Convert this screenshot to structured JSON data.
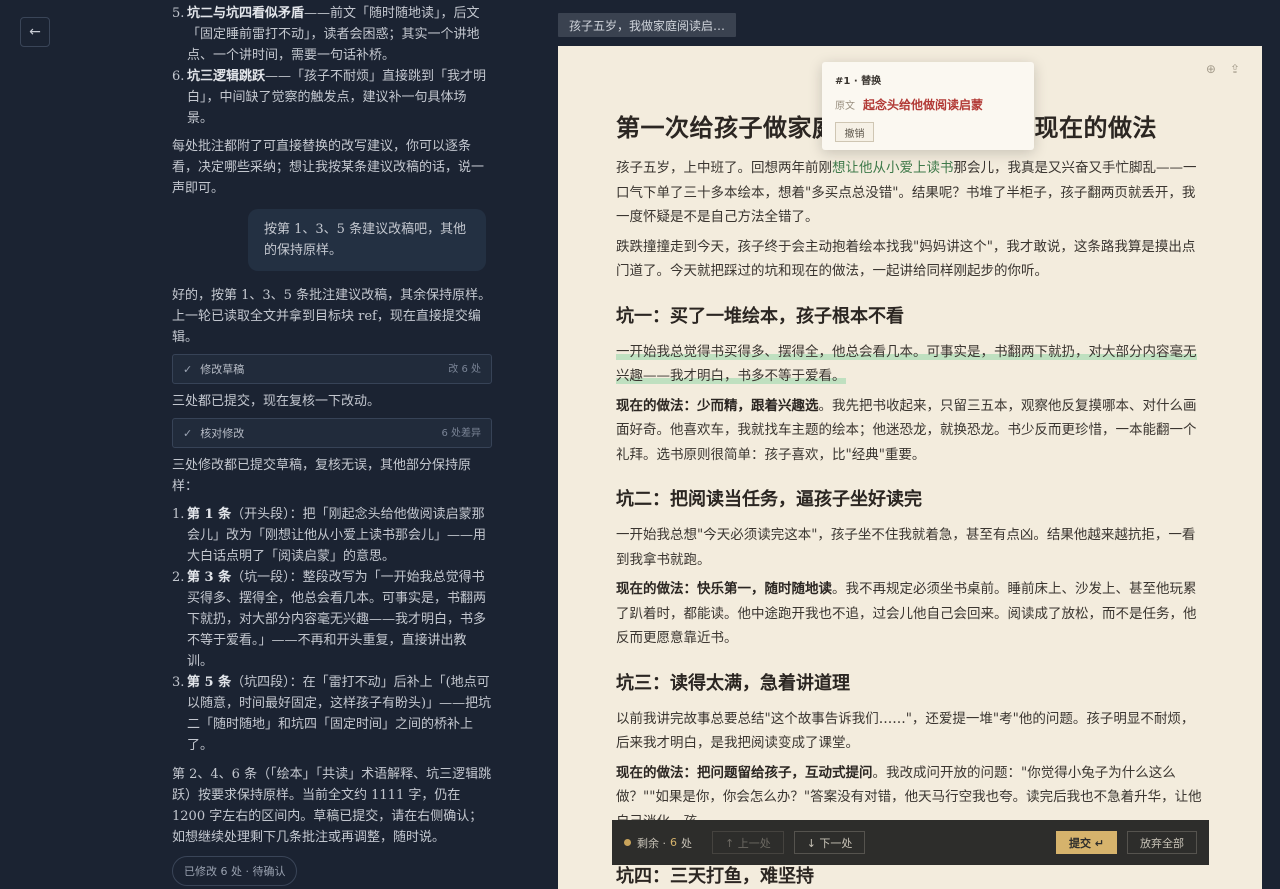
{
  "nav": {
    "back_icon": "←"
  },
  "chat": {
    "top_list": [
      {
        "num": "5.",
        "title": "坑二与坑四看似矛盾",
        "text": "——前文「随时随地读」，后文「固定睡前雷打不动」，读者会困惑；其实一个讲地点、一个讲时间，需要一句话补桥。"
      },
      {
        "num": "6.",
        "title": "坑三逻辑跳跃",
        "text": "——「孩子不耐烦」直接跳到「我才明白」，中间缺了觉察的触发点，建议补一句具体场景。"
      }
    ],
    "p1": "每处批注都附了可直接替换的改写建议，你可以逐条看，决定哪些采纳；想让我按某条建议改稿的话，说一声即可。",
    "user_msg": "按第 1、3、5 条建议改稿吧，其他的保持原样。",
    "p2": "好的，按第 1、3、5 条批注建议改稿，其余保持原样。上一轮已读取全文并拿到目标块 ref，现在直接提交编辑。",
    "tool1": {
      "label": "修改草稿",
      "right": "改 6 处",
      "icon": "✓"
    },
    "p3": "三处都已提交，现在复核一下改动。",
    "tool2": {
      "label": "核对修改",
      "right": "6 处差异",
      "icon": "✓"
    },
    "p4": "三处修改都已提交草稿，复核无误，其他部分保持原样：",
    "changes": [
      {
        "num": "1.",
        "title": "第 1 条",
        "text": "（开头段）：把「刚起念头给他做阅读启蒙那会儿」改为「刚想让他从小爱上读书那会儿」——用大白话点明了「阅读启蒙」的意思。"
      },
      {
        "num": "2.",
        "title": "第 3 条",
        "text": "（坑一段）：整段改写为「一开始我总觉得书买得多、摆得全，他总会看几本。可事实是，书翻两下就扔，对大部分内容毫无兴趣——我才明白，书多不等于爱看。」——不再和开头重复，直接讲出教训。"
      },
      {
        "num": "3.",
        "title": "第 5 条",
        "text": "（坑四段）：在「雷打不动」后补上「(地点可以随意，时间最好固定，这样孩子有盼头)」——把坑二「随时随地」和坑四「固定时间」之间的桥补上了。"
      }
    ],
    "p5": "第 2、4、6 条（「绘本」「共读」术语解释、坑三逻辑跳跃）按要求保持原样。当前全文约 1111 字，仍在 1200 字左右的区间内。草稿已提交，请在右侧确认；如想继续处理剩下几条批注或再调整，随时说。",
    "status": "已修改  6  处  ·  待确认"
  },
  "doc": {
    "tab_title": "孩子五岁，我做家庭阅读启…",
    "icons": [
      "zoom-icon",
      "share-icon"
    ],
    "h1_left": "第一次给孩子做家庭",
    "h1_right": "坑和现在的做法",
    "intro1_a": "孩子五岁，上中班了。回想两年前刚",
    "intro1_ins": "想让他从小爱上读书",
    "intro1_b": "那会儿，我真是又兴奋又手忙脚乱——一口气下单了三十多本绘本，想着\"多买点总没错\"。结果呢？书堆了半柜子，孩子翻两页就丢开，我一度怀疑是不是自己方法全错了。",
    "intro2": "跌跌撞撞走到今天，孩子终于会主动抱着绘本找我\"妈妈讲这个\"，我才敢说，这条路我算是摸出点门道了。今天就把踩过的坑和现在的做法，一起讲给同样刚起步的你听。",
    "s1_title": "坑一：买了一堆绘本，孩子根本不看",
    "s1_p1": "一开始我总觉得书买得多、摆得全，他总会看几本。可事实是，书翻两下就扔，对大部分内容毫无兴趣——我才明白，书多不等于爱看。",
    "s1_now_label": "现在的做法：少而精，跟着兴趣选",
    "s1_now": "。我先把书收起来，只留三五本，观察他反复摸哪本、对什么画面好奇。他喜欢车，我就找车主题的绘本；他迷恐龙，就换恐龙。书少反而更珍惜，一本能翻一个礼拜。选书原则很简单：孩子喜欢，比\"经典\"重要。",
    "s2_title": "坑二：把阅读当任务，逼孩子坐好读完",
    "s2_p1": "一开始我总想\"今天必须读完这本\"，孩子坐不住我就着急，甚至有点凶。结果他越来越抗拒，一看到我拿书就跑。",
    "s2_now_label": "现在的做法：快乐第一，随时随地读",
    "s2_now": "。我不再规定必须坐书桌前。睡前床上、沙发上、甚至他玩累了趴着时，都能读。他中途跑开我也不追，过会儿他自己会回来。阅读成了放松，而不是任务，他反而更愿意靠近书。",
    "s3_title": "坑三：读得太满，急着讲道理",
    "s3_p1": "以前我讲完故事总要总结\"这个故事告诉我们……\"，还爱提一堆\"考\"他的问题。孩子明显不耐烦，后来我才明白，是我把阅读变成了课堂。",
    "s3_now_label": "现在的做法：把问题留给孩子，互动式提问",
    "s3_now": "。我改成问开放的问题：\"你觉得小兔子为什么这么做？\"\"如果是你，你会怎么办？\"答案没有对错，他天马行空我也夸。读完后我也不急着升华，让他自己消化。孩",
    "s4_title": "坑四：三天打鱼，难坚持"
  },
  "popover": {
    "header": "#1  ·  替换",
    "orig_label": "原文",
    "orig_text": "起念头给他做阅读启蒙",
    "undo": "撤销"
  },
  "review_bar": {
    "remaining_label": "剩余 ·",
    "remaining_count": "6",
    "remaining_unit": "处",
    "prev": "↑ 上一处",
    "next": "↓ 下一处",
    "submit": "提交 ↵",
    "discard": "放弃全部"
  },
  "colors": {
    "page_bg": "#1b2332",
    "paper_bg": "#f3ecdd",
    "accent_gold": "#d6b36c",
    "red_orig": "#b23a36",
    "insert_green": "#3f7a4a"
  }
}
